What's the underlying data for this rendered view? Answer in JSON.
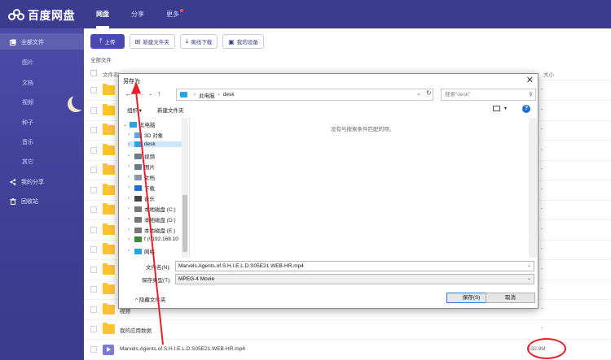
{
  "app": {
    "name": "百度网盘"
  },
  "topnav": {
    "items": [
      "网盘",
      "分享",
      "更多"
    ]
  },
  "sidebar": {
    "all_files": "全部文件",
    "categories": [
      "图片",
      "文档",
      "视频",
      "种子",
      "音乐",
      "其它"
    ],
    "my_share": "我的分享",
    "recycle": "回收站"
  },
  "toolbar": {
    "upload": "上传",
    "new_folder": "新建文件夹",
    "offline_download": "离线下载",
    "my_device": "我的设备"
  },
  "breadcrumb": "全部文件",
  "table": {
    "col_name": "文件名",
    "col_size": "大小",
    "rows": [
      {
        "name": "",
        "size": "-"
      },
      {
        "name": "",
        "size": "-"
      },
      {
        "name": "",
        "size": "-"
      },
      {
        "name": "",
        "size": "-"
      },
      {
        "name": "",
        "size": "-"
      },
      {
        "name": "",
        "size": "-"
      },
      {
        "name": "",
        "size": "-"
      },
      {
        "name": "",
        "size": "-"
      },
      {
        "name": "",
        "size": "-"
      },
      {
        "name": "",
        "size": "-"
      },
      {
        "name": "",
        "size": "-"
      },
      {
        "name": "视频",
        "size": "-"
      },
      {
        "name": "我的应用数据",
        "size": "-"
      },
      {
        "name": "Marvels.Agents.of.S.H.I.E.L.D.S05E21.WEB-HR.mp4",
        "size": "532.9M"
      }
    ]
  },
  "dialog": {
    "title": "另存为",
    "path_root": "此电脑",
    "path_leaf": "desk",
    "search_placeholder": "搜索\"desk\"",
    "organize": "组织 ▾",
    "new_folder": "新建文件夹",
    "empty_message": "没有与搜索条件匹配的项。",
    "tree": [
      {
        "label": "此电脑",
        "icon": "pc-icon"
      },
      {
        "label": "3D 对象",
        "icon": "3d-objects-icon"
      },
      {
        "label": "desk",
        "icon": "folder-icon"
      },
      {
        "label": "视频",
        "icon": "video-folder-icon"
      },
      {
        "label": "图片",
        "icon": "pictures-folder-icon"
      },
      {
        "label": "文档",
        "icon": "documents-folder-icon"
      },
      {
        "label": "下载",
        "icon": "download-folder-icon"
      },
      {
        "label": "音乐",
        "icon": "music-folder-icon"
      },
      {
        "label": "本地磁盘 (C:)",
        "icon": "drive-icon"
      },
      {
        "label": "本地磁盘 (D:)",
        "icon": "drive-icon"
      },
      {
        "label": "本地磁盘 (E:)",
        "icon": "drive-icon"
      },
      {
        "label": "f (\\\\192.168.10",
        "icon": "network-drive-icon"
      },
      {
        "label": "网络",
        "icon": "network-icon"
      }
    ],
    "filename_label": "文件名(N):",
    "filename_value": "Marvels.Agents.of.S.H.I.E.L.D.S05E21.WEB-HR.mp4",
    "filetype_label": "保存类型(T):",
    "filetype_value": "MPEG-4 Movie",
    "hide_folders": "隐藏文件夹",
    "save": "保存(S)",
    "cancel": "取消"
  },
  "colors": {
    "topbar": "#3b3c8f",
    "sidebar": "#4c4ba8",
    "primary": "#4a49b2",
    "folder": "#ffc233",
    "annotation": "#e8202a"
  }
}
